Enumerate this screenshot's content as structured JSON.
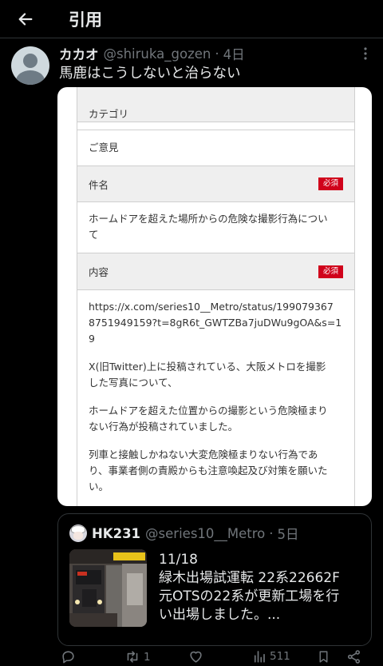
{
  "header": {
    "title": "引用"
  },
  "post": {
    "display_name": "カカオ",
    "handle": "@shiruka_gozen",
    "separator": "·",
    "time": "4日",
    "text": "馬鹿はこうしないと治らない"
  },
  "form": {
    "category_label": "カテゴリ",
    "category_value": "ご意見",
    "subject_label": "件名",
    "required_badge": "必須",
    "subject_value_1": "ホームドアを超えた場所からの危険な撮影行為につい",
    "subject_value_2": "て",
    "content_label": "内容",
    "content_lines": [
      "https://x.com/series10__Metro/status/199079367",
      "8751949159?t=8gR6t_GWTZBa7juDWu9gOA&s=1",
      "9",
      "X(旧Twitter)上に投稿されている、大阪メトロを撮影",
      "した写真について、",
      "ホームドアを超えた位置からの撮影という危険極まり",
      "ない行為が投稿されていました。",
      "列車と接触しかねない大変危険極まりない行為であ",
      "り、事業者側の責殿からも注意喚起及び対策を願いた",
      "い。"
    ]
  },
  "quote": {
    "display_name": "HK231",
    "handle": "@series10__Metro",
    "separator": "·",
    "time": "5日",
    "text_lines": [
      "11/18",
      "緑木出場試運転 22系22662F",
      "元OTSの22系が更新工場を行",
      "い出場しました。..."
    ]
  },
  "actions": {
    "retweets": "1",
    "views": "511"
  },
  "colors": {
    "background": "#000000",
    "text_primary": "#e7e9ea",
    "text_secondary": "#71767b",
    "border": "#2f3336",
    "required_red": "#d0021b"
  },
  "icons": [
    "back-arrow-icon",
    "more-icon",
    "reply-icon",
    "retweet-icon",
    "like-icon",
    "views-icon",
    "bookmark-icon",
    "share-icon"
  ]
}
